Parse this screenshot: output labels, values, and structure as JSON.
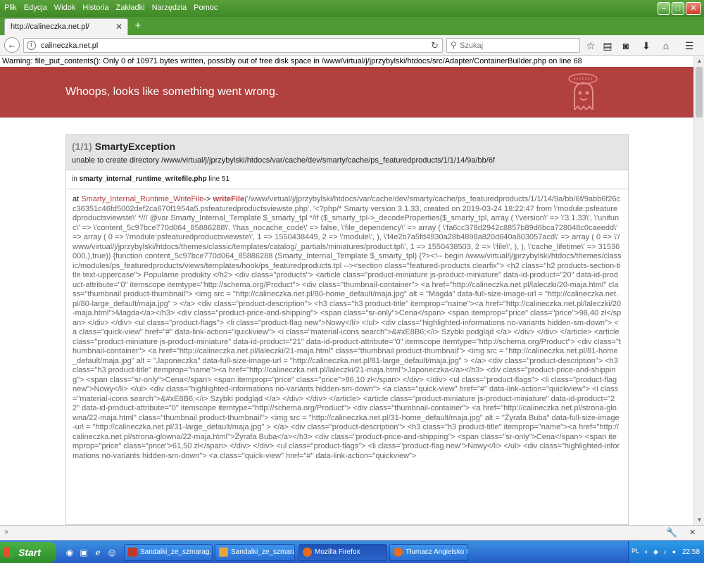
{
  "menu": [
    "Plik",
    "Edycja",
    "Widok",
    "Historia",
    "Zakładki",
    "Narzędzia",
    "Pomoc"
  ],
  "tab": {
    "title": "http://calineczka.net.pl/"
  },
  "urlbar": {
    "url": "calineczka.net.pl"
  },
  "search": {
    "placeholder": "Szukaj"
  },
  "page": {
    "warning": "Warning: file_put_contents(): Only 0 of 10971 bytes written, possibly out of free disk space in /www/virtual/j/jprzybylski/htdocs/src/Adapter/ContainerBuilder.php on line 68",
    "banner_title": "Whoops, looks like something went wrong.",
    "exception": {
      "count": "(1/1)",
      "name": "SmartyException",
      "message": "unable to create directory /www/virtual/j/jprzybylski/htdocs/var/cache/dev/smarty/cache/ps_featuredproducts/1/1/14/9a/bb/6f",
      "location_prefix": "in",
      "location_file": "smarty_internal_runtime_writefile.php",
      "location_line": "line 51",
      "trace_at": "at",
      "trace_class": "Smarty_Internal_Runtime_WriteFile",
      "trace_arrow": "->",
      "trace_function": "writeFile",
      "trace_args": "('/www/virtual/j/jprzybylski/htdocs/var/cache/dev/smarty/cache/ps_featuredproducts/1/1/14/9a/bb/6f/9abb6f26cc36351c46fd5002def2ca670f1954a5.psfeaturedproductsviewste.php', '<?php/* Smarty version 3.1.33, created on 2019-03-24 18:22:47 from \\'module:psfeaturedproductsviewste\\' */// @var Smarty_Internal_Template $_smarty_tpl */if ($_smarty_tpl->_decodeProperties($_smarty_tpl, array ( \\'version\\' => \\'3.1.33\\', \\'unifunc\\' => \\'content_5c97bce770d064_85886288\\', \\'has_nocache_code\\' => false, \\'file_dependency\\' => array ( \\'fa6cc378d2942c8857b89d6bca728048c0caeedd\\' => array ( 0 => \\'module:psfeaturedproductsviewste\\', 1 => 1550438449, 2 => \\'module\\', ), \\'f4e2b7a5fd4930a28b4898a820d640a803057acd\\' => array ( 0 => \\'/www/virtual/j/jprzybylski/htdocs/themes/classic/templates/catalog/_partials/miniatures/product.tpl\\', 1 => 1550438503, 2 => \\'file\\', ), ), \\'cache_lifetime\\' => 31536000,),true)) {function content_5c97bce770d064_85886288 (Smarty_Internal_Template $_smarty_tpl) {?><!-- begin /www/virtual/j/jprzybylski/htdocs/themes/classic/modules/ps_featuredproducts/views/templates/hook/ps_featuredproducts.tpl --><section class=\"featured-products clearfix\"> <h2 class=\"h2 products-section-title text-uppercase\"> Popularne produkty </h2> <div class=\"products\"> <article class=\"product-miniature js-product-miniature\" data-id-product=\"20\" data-id-product-attribute=\"0\" itemscope itemtype=\"http://schema.org/Product\"> <div class=\"thumbnail-container\"> <a href=\"http://calineczka.net.pl/laleczki/20-maja.html\" class=\"thumbnail product-thumbnail\"> <img src = \"http://calineczka.net.pl/80-home_default/maja.jpg\" alt = \"Magda\" data-full-size-image-url = \"http://calineczka.net.pl/80-large_default/maja.jpg\" > </a> <div class=\"product-description\"> <h3 class=\"h3 product-title\" itemprop=\"name\"><a href=\"http://calineczka.net.pl/laleczki/20-maja.html\">Magda</a></h3> <div class=\"product-price-and-shipping\"> <span class=\"sr-only\">Cena</span> <span itemprop=\"price\" class=\"price\">98,40 zł</span> </div> </div> <ul class=\"product-flags\"> <li class=\"product-flag new\">Nowy</li> </ul> <div class=\"highlighted-informations no-variants hidden-sm-down\"> <a class=\"quick-view\" href=\"#\" data-link-action=\"quickview\"> <i class=\"material-icons search\">&#xE8B6;</i> Szybki podgląd </a> </div> </div> </article> <article class=\"product-miniature js-product-miniature\" data-id-product=\"21\" data-id-product-attribute=\"0\" itemscope itemtype=\"http://schema.org/Product\"> <div class=\"thumbnail-container\"> <a href=\"http://calineczka.net.pl/laleczki/21-maja.html\" class=\"thumbnail product-thumbnail\"> <img src = \"http://calineczka.net.pl/81-home_default/maja.jpg\" alt = \"Japoneczka\" data-full-size-image-url = \"http://calineczka.net.pl/81-large_default/maja.jpg\" > </a> <div class=\"product-description\"> <h3 class=\"h3 product-title\" itemprop=\"name\"><a href=\"http://calineczka.net.pl/laleczki/21-maja.html\">Japoneczka</a></h3> <div class=\"product-price-and-shipping\"> <span class=\"sr-only\">Cena</span> <span itemprop=\"price\" class=\"price\">86,10 zł</span> </div> </div> <ul class=\"product-flags\"> <li class=\"product-flag new\">Nowy</li> </ul> <div class=\"highlighted-informations no-variants hidden-sm-down\"> <a class=\"quick-view\" href=\"#\" data-link-action=\"quickview\"> <i class=\"material-icons search\">&#xE8B6;</i> Szybki podgląd </a> </div> </div> </article> <article class=\"product-miniature js-product-miniature\" data-id-product=\"22\" data-id-product-attribute=\"0\" itemscope itemtype=\"http://schema.org/Product\"> <div class=\"thumbnail-container\"> <a href=\"http://calineczka.net.pl/strona-glowna/22-maja.html\" class=\"thumbnail product-thumbnail\"> <img src = \"http://calineczka.net.pl/31-home_default/maja.jpg\" alt = \"Żyrafa Buba\" data-full-size-image-url = \"http://calineczka.net.pl/31-large_default/maja.jpg\" > </a> <div class=\"product-description\"> <h3 class=\"h3 product-title\" itemprop=\"name\"><a href=\"http://calineczka.net.pl/strona-glowna/22-maja.html\">Żyrafa Buba</a></h3> <div class=\"product-price-and-shipping\"> <span class=\"sr-only\">Cena</span> <span itemprop=\"price\" class=\"price\">61,50 zł</span> </div> </div> <ul class=\"product-flags\"> <li class=\"product-flag new\">Nowy</li> </ul> <div class=\"highlighted-informations no-variants hidden-sm-down\"> <a class=\"quick-view\" href=\"#\" data-link-action=\"quickview\">"
    }
  },
  "taskbar": {
    "start": "Start",
    "tasks": [
      "Sandalki_ze_szmarag...",
      "Sandalki_ze_szmarag...",
      "Mozilla Firefox",
      "Tłumacz Angielsko Pol..."
    ],
    "language": "PL",
    "clock": "22:58"
  },
  "colors": {
    "banner": "#b0413e",
    "titlebar": "#4e9b33",
    "taskbar": "#245bc6"
  }
}
